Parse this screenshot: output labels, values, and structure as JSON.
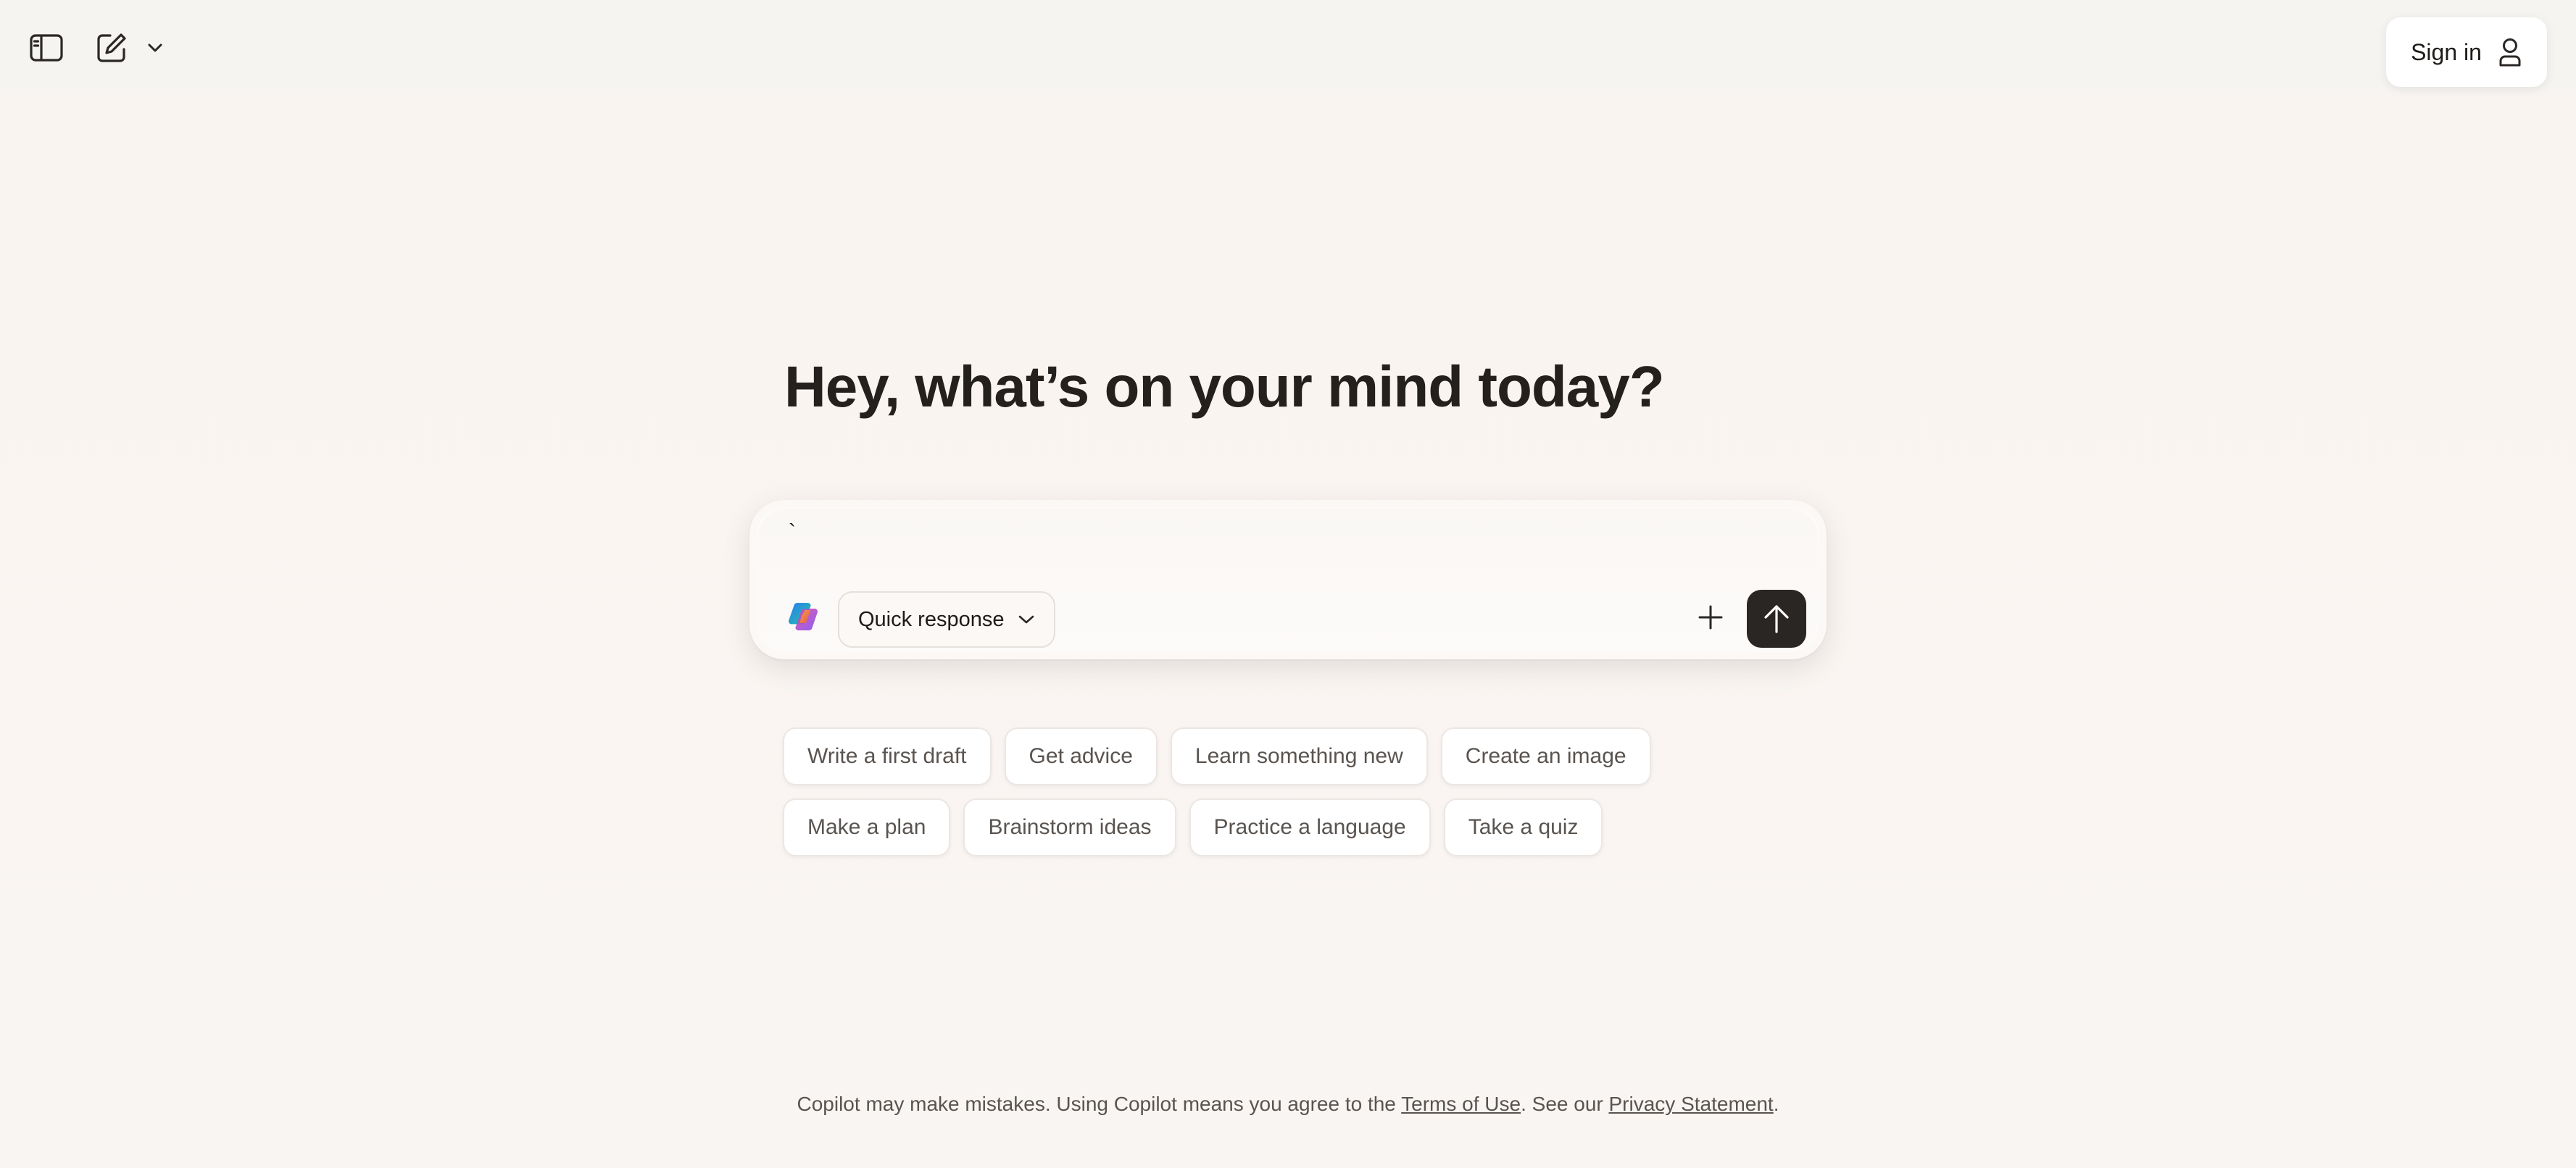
{
  "topbar": {
    "sidebar_toggle_icon": "sidebar-icon",
    "new_chat_icon": "compose-icon",
    "menu_icon": "chevron-down-icon",
    "sign_in_label": "Sign in",
    "account_icon": "person-icon"
  },
  "main": {
    "heading": "Hey, what’s on your mind today?"
  },
  "composer": {
    "input_value": "`",
    "mode_label": "Quick response",
    "logo_icon": "copilot-logo",
    "add_icon": "plus-icon",
    "send_icon": "arrow-up-icon"
  },
  "suggestions": {
    "row1": [
      "Write a first draft",
      "Get advice",
      "Learn something new",
      "Create an image"
    ],
    "row2": [
      "Make a plan",
      "Brainstorm ideas",
      "Practice a language",
      "Take a quiz"
    ]
  },
  "footer": {
    "text_before": "Copilot may make mistakes. Using Copilot means you agree to the ",
    "terms_link": "Terms of Use",
    "text_middle": ". See our ",
    "privacy_link": "Privacy Statement",
    "text_after": "."
  },
  "colors": {
    "background": "#f9f5f2",
    "send_button": "#2a2623",
    "chip_background": "#ffffff"
  }
}
